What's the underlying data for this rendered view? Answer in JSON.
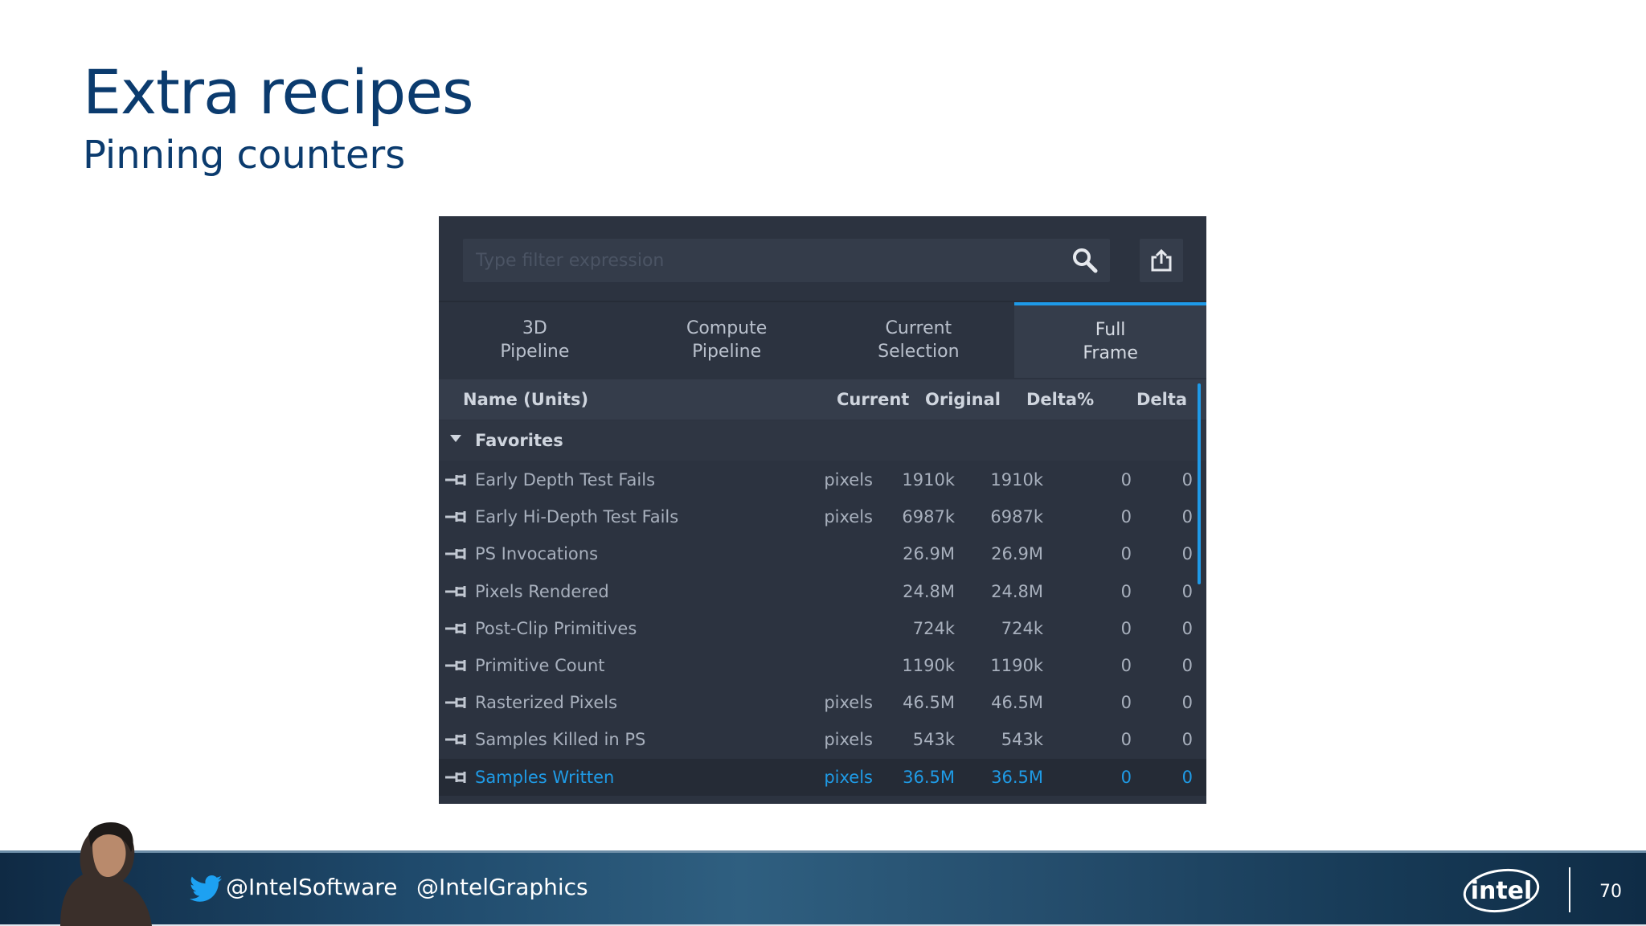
{
  "slide": {
    "title": "Extra recipes",
    "subtitle": "Pinning counters"
  },
  "filter": {
    "placeholder": "Type filter expression",
    "value": ""
  },
  "icons": {
    "search": "search-icon",
    "share": "share-icon",
    "pin": "pin-icon",
    "caret": "caret-down-icon"
  },
  "tabs": [
    {
      "label": "3D\nPipeline",
      "active": false
    },
    {
      "label": "Compute\nPipeline",
      "active": false
    },
    {
      "label": "Current\nSelection",
      "active": false
    },
    {
      "label": "Full\nFrame",
      "active": true
    }
  ],
  "columns": {
    "name": "Name (Units)",
    "current": "Current",
    "original": "Original",
    "delta_pct": "Delta%",
    "delta": "Delta"
  },
  "group": {
    "label": "Favorites"
  },
  "rows": [
    {
      "name": "Early Depth Test Fails",
      "unit": "pixels",
      "current": "1910k",
      "original": "1910k",
      "delta_pct": "0",
      "delta": "0"
    },
    {
      "name": "Early Hi-Depth Test Fails",
      "unit": "pixels",
      "current": "6987k",
      "original": "6987k",
      "delta_pct": "0",
      "delta": "0"
    },
    {
      "name": "PS Invocations",
      "unit": "",
      "current": "26.9M",
      "original": "26.9M",
      "delta_pct": "0",
      "delta": "0"
    },
    {
      "name": "Pixels Rendered",
      "unit": "",
      "current": "24.8M",
      "original": "24.8M",
      "delta_pct": "0",
      "delta": "0"
    },
    {
      "name": "Post-Clip Primitives",
      "unit": "",
      "current": "724k",
      "original": "724k",
      "delta_pct": "0",
      "delta": "0"
    },
    {
      "name": "Primitive Count",
      "unit": "",
      "current": "1190k",
      "original": "1190k",
      "delta_pct": "0",
      "delta": "0"
    },
    {
      "name": "Rasterized Pixels",
      "unit": "pixels",
      "current": "46.5M",
      "original": "46.5M",
      "delta_pct": "0",
      "delta": "0"
    },
    {
      "name": "Samples Killed in PS",
      "unit": "pixels",
      "current": "543k",
      "original": "543k",
      "delta_pct": "0",
      "delta": "0"
    },
    {
      "name": "Samples Written",
      "unit": "pixels",
      "current": "36.5M",
      "original": "36.5M",
      "delta_pct": "0",
      "delta": "0",
      "selected": true
    }
  ],
  "footer": {
    "twitter_1": "@IntelSoftware",
    "twitter_2": "@IntelGraphics",
    "logo_text": "intel",
    "page_number": "70"
  },
  "colors": {
    "title": "#0b3b6e",
    "panel_bg": "#2c3340",
    "accent": "#1e9ae8",
    "selected_text": "#1f9be6"
  }
}
